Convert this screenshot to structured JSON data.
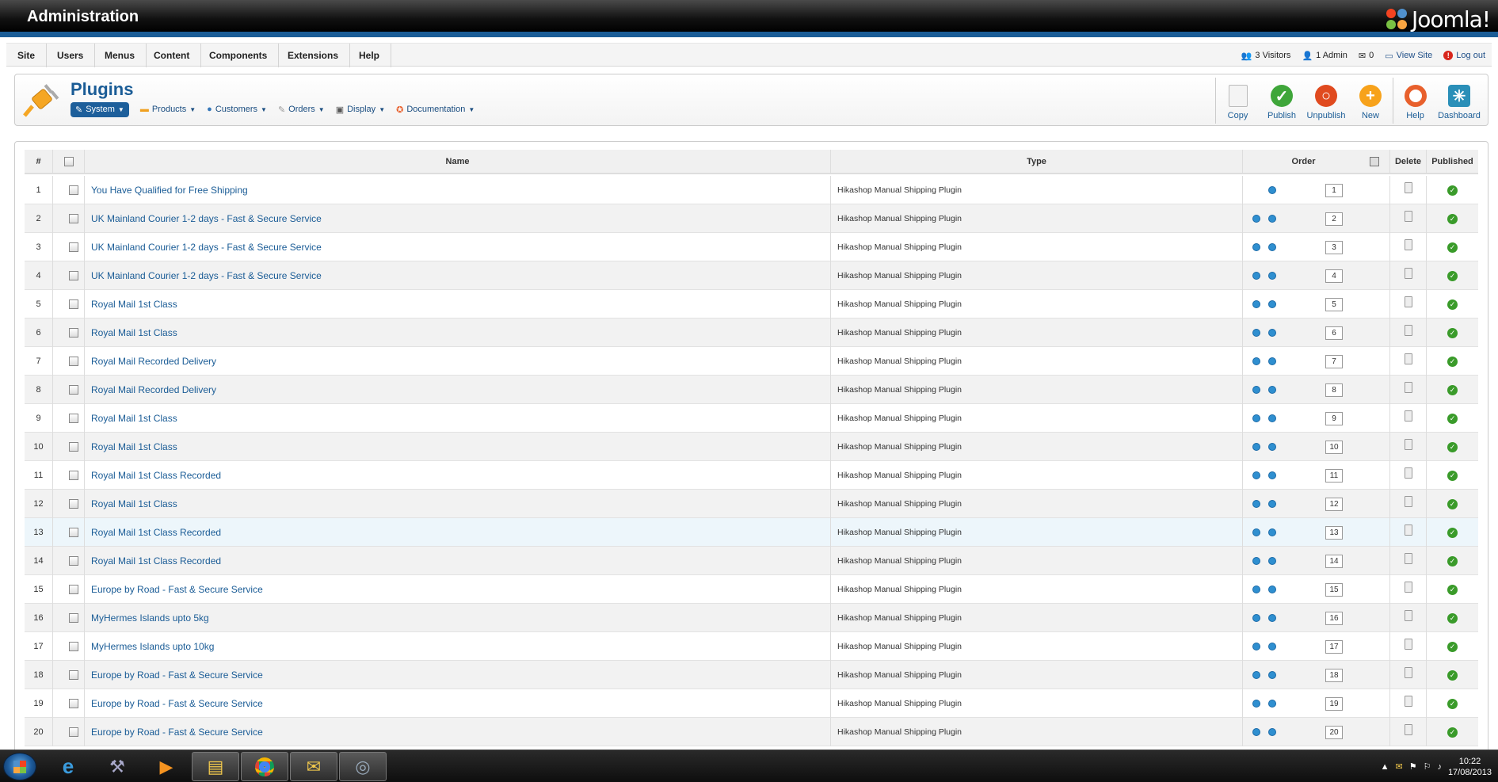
{
  "header": {
    "title": "Administration",
    "brand": "Joomla!"
  },
  "menu": [
    "Site",
    "Users",
    "Menus",
    "Content",
    "Components",
    "Extensions",
    "Help"
  ],
  "status": {
    "visitors": "3 Visitors",
    "admins": "1 Admin",
    "messages": "0",
    "view_site": "View Site",
    "logout": "Log out"
  },
  "page": {
    "title": "Plugins"
  },
  "submenu": [
    {
      "label": "System",
      "icon": "wrench-icon",
      "active": true
    },
    {
      "label": "Products",
      "icon": "products-icon"
    },
    {
      "label": "Customers",
      "icon": "customers-icon"
    },
    {
      "label": "Orders",
      "icon": "orders-icon"
    },
    {
      "label": "Display",
      "icon": "display-icon"
    },
    {
      "label": "Documentation",
      "icon": "lifebuoy-icon"
    }
  ],
  "toolbar": [
    {
      "label": "Copy",
      "icon": "copy-icon"
    },
    {
      "label": "Publish",
      "icon": "publish-icon",
      "color": "#3fa63a"
    },
    {
      "label": "Unpublish",
      "icon": "unpublish-icon",
      "color": "#e04a1f"
    },
    {
      "label": "New",
      "icon": "new-icon",
      "color": "#f7a21b"
    },
    {
      "label": "Help",
      "icon": "help-icon",
      "color": "#e8602c"
    },
    {
      "label": "Dashboard",
      "icon": "dashboard-icon",
      "color": "#2a8fb8"
    }
  ],
  "table": {
    "headers": {
      "num": "#",
      "name": "Name",
      "type": "Type",
      "order": "Order",
      "delete": "Delete",
      "published": "Published"
    },
    "rows": [
      {
        "num": "1",
        "name": "You Have Qualified for Free Shipping",
        "type": "Hikashop Manual Shipping Plugin",
        "order": "1"
      },
      {
        "num": "2",
        "name": "UK Mainland Courier 1-2 days - Fast & Secure Service",
        "type": "Hikashop Manual Shipping Plugin",
        "order": "2"
      },
      {
        "num": "3",
        "name": "UK Mainland Courier 1-2 days - Fast & Secure Service",
        "type": "Hikashop Manual Shipping Plugin",
        "order": "3"
      },
      {
        "num": "4",
        "name": "UK Mainland Courier 1-2 days - Fast & Secure Service",
        "type": "Hikashop Manual Shipping Plugin",
        "order": "4"
      },
      {
        "num": "5",
        "name": "Royal Mail 1st Class",
        "type": "Hikashop Manual Shipping Plugin",
        "order": "5"
      },
      {
        "num": "6",
        "name": "Royal Mail 1st Class",
        "type": "Hikashop Manual Shipping Plugin",
        "order": "6"
      },
      {
        "num": "7",
        "name": "Royal Mail Recorded Delivery",
        "type": "Hikashop Manual Shipping Plugin",
        "order": "7"
      },
      {
        "num": "8",
        "name": "Royal Mail Recorded Delivery",
        "type": "Hikashop Manual Shipping Plugin",
        "order": "8"
      },
      {
        "num": "9",
        "name": "Royal Mail 1st Class",
        "type": "Hikashop Manual Shipping Plugin",
        "order": "9"
      },
      {
        "num": "10",
        "name": "Royal Mail 1st Class",
        "type": "Hikashop Manual Shipping Plugin",
        "order": "10"
      },
      {
        "num": "11",
        "name": "Royal Mail 1st Class Recorded",
        "type": "Hikashop Manual Shipping Plugin",
        "order": "11"
      },
      {
        "num": "12",
        "name": "Royal Mail 1st Class",
        "type": "Hikashop Manual Shipping Plugin",
        "order": "12"
      },
      {
        "num": "13",
        "name": "Royal Mail 1st Class Recorded",
        "type": "Hikashop Manual Shipping Plugin",
        "order": "13"
      },
      {
        "num": "14",
        "name": "Royal Mail 1st Class Recorded",
        "type": "Hikashop Manual Shipping Plugin",
        "order": "14"
      },
      {
        "num": "15",
        "name": "Europe by Road - Fast & Secure Service",
        "type": "Hikashop Manual Shipping Plugin",
        "order": "15"
      },
      {
        "num": "16",
        "name": "MyHermes Islands upto 5kg",
        "type": "Hikashop Manual Shipping Plugin",
        "order": "16"
      },
      {
        "num": "17",
        "name": "MyHermes Islands upto 10kg",
        "type": "Hikashop Manual Shipping Plugin",
        "order": "17"
      },
      {
        "num": "18",
        "name": "Europe by Road - Fast & Secure Service",
        "type": "Hikashop Manual Shipping Plugin",
        "order": "18"
      },
      {
        "num": "19",
        "name": "Europe by Road - Fast & Secure Service",
        "type": "Hikashop Manual Shipping Plugin",
        "order": "19"
      },
      {
        "num": "20",
        "name": "Europe by Road - Fast & Secure Service",
        "type": "Hikashop Manual Shipping Plugin",
        "order": "20"
      }
    ]
  },
  "taskbar": {
    "time": "10:22",
    "date": "17/08/2013",
    "apps": [
      "ie-icon",
      "tools-icon",
      "media-player-icon",
      "explorer-icon",
      "chrome-icon",
      "mail-icon",
      "screenshot-icon"
    ]
  }
}
